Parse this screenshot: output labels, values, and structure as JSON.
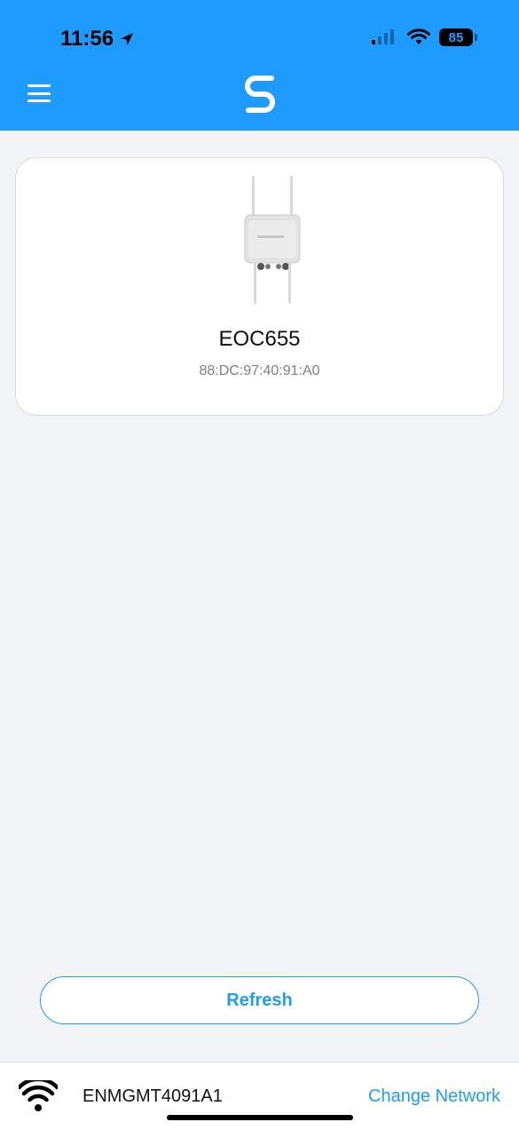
{
  "status_bar": {
    "time": "11:56",
    "battery": "85",
    "icons": [
      "location-arrow-icon",
      "cellular-signal-icon",
      "wifi-icon",
      "battery-icon"
    ]
  },
  "header": {
    "menu_icon": "hamburger-menu-icon",
    "logo_icon": "s-logo-icon",
    "accent_color": "#1e9bff"
  },
  "devices": [
    {
      "name": "EOC655",
      "mac": "88:DC:97:40:91:A0",
      "image_icon": "outdoor-access-point-icon"
    }
  ],
  "actions": {
    "refresh_label": "Refresh"
  },
  "footer": {
    "network_icon": "wifi-icon",
    "network_name": "ENMGMT4091A1",
    "change_network_label": "Change Network"
  }
}
